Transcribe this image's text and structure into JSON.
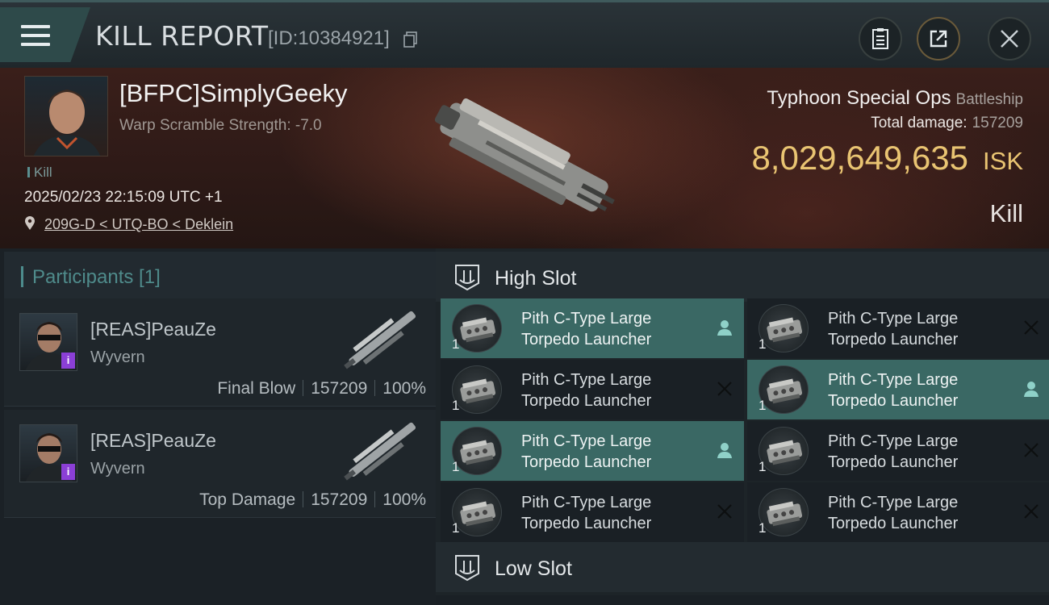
{
  "header": {
    "title": "KILL REPORT",
    "report_id": "[ID:10384921]"
  },
  "victim": {
    "name": "[BFPC]SimplyGeeky",
    "warp_scramble": "Warp Scramble Strength: -7.0",
    "kill_tag": "Kill",
    "datetime": "2025/02/23 22:15:09 UTC +1",
    "location": "209G-D < UTQ-BO < Deklein"
  },
  "ship": {
    "name": "Typhoon Special Ops",
    "class": "Battleship",
    "total_damage_label": "Total damage:",
    "total_damage": "157209",
    "isk_value": "8,029,649,635",
    "isk_unit": "ISK",
    "result": "Kill"
  },
  "participants": {
    "header": "Participants [1]",
    "rows": [
      {
        "name": "[REAS]PeauZe",
        "ship": "Wyvern",
        "role": "Final Blow",
        "damage": "157209",
        "percent": "100%",
        "badge": "i"
      },
      {
        "name": "[REAS]PeauZe",
        "ship": "Wyvern",
        "role": "Top Damage",
        "damage": "157209",
        "percent": "100%",
        "badge": "i"
      }
    ]
  },
  "slots": {
    "high_label": "High Slot",
    "low_label": "Low Slot",
    "high_modules": [
      {
        "line1": "Pith C-Type Large",
        "line2": "Torpedo Launcher",
        "qty": "1",
        "state": "dropped"
      },
      {
        "line1": "Pith C-Type Large",
        "line2": "Torpedo Launcher",
        "qty": "1",
        "state": "destroyed"
      },
      {
        "line1": "Pith C-Type Large",
        "line2": "Torpedo Launcher",
        "qty": "1",
        "state": "destroyed"
      },
      {
        "line1": "Pith C-Type Large",
        "line2": "Torpedo Launcher",
        "qty": "1",
        "state": "dropped"
      },
      {
        "line1": "Pith C-Type Large",
        "line2": "Torpedo Launcher",
        "qty": "1",
        "state": "dropped"
      },
      {
        "line1": "Pith C-Type Large",
        "line2": "Torpedo Launcher",
        "qty": "1",
        "state": "destroyed"
      },
      {
        "line1": "Pith C-Type Large",
        "line2": "Torpedo Launcher",
        "qty": "1",
        "state": "destroyed"
      },
      {
        "line1": "Pith C-Type Large",
        "line2": "Torpedo Launcher",
        "qty": "1",
        "state": "destroyed"
      }
    ]
  },
  "colors": {
    "accent_teal": "#3a6864",
    "isk_gold": "#e9c472",
    "badge_purple": "#8b3fd6"
  }
}
